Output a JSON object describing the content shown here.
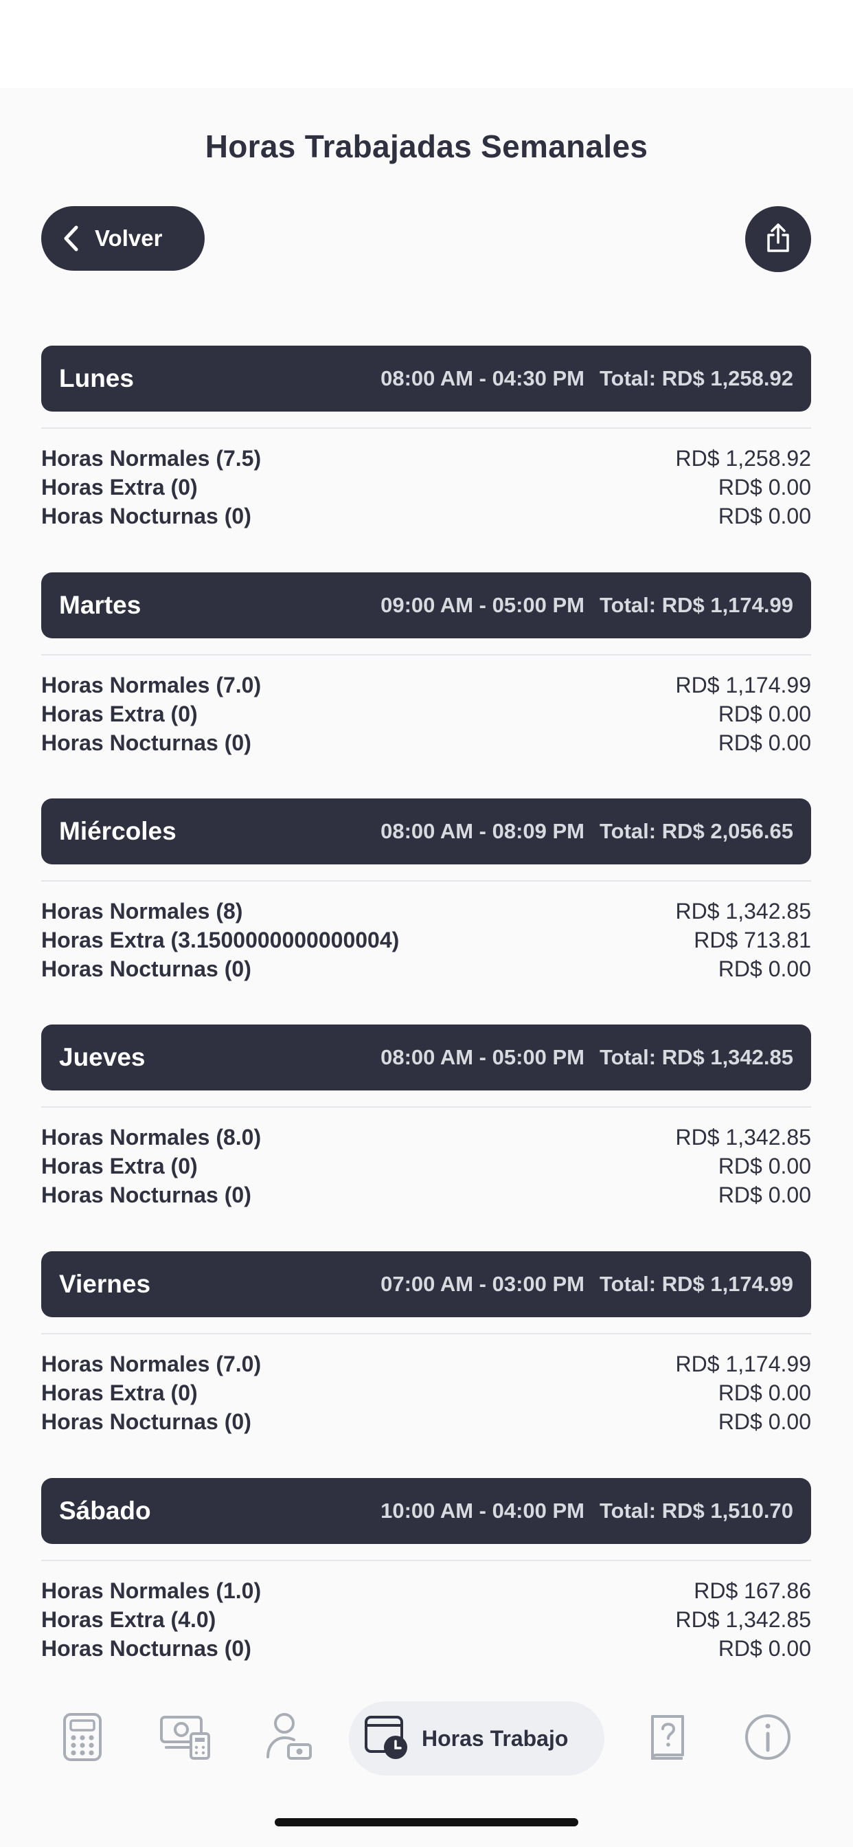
{
  "header": {
    "title": "Horas Trabajadas Semanales",
    "back_label": "Volver"
  },
  "days": [
    {
      "name": "Lunes",
      "hours": "08:00 AM - 04:30 PM",
      "total": "Total: RD$ 1,258.92",
      "lines": [
        {
          "label": "Horas Normales (7.5)",
          "amount": "RD$ 1,258.92"
        },
        {
          "label": "Horas Extra (0)",
          "amount": "RD$ 0.00"
        },
        {
          "label": "Horas Nocturnas (0)",
          "amount": "RD$ 0.00"
        }
      ]
    },
    {
      "name": "Martes",
      "hours": "09:00 AM - 05:00 PM",
      "total": "Total: RD$ 1,174.99",
      "lines": [
        {
          "label": "Horas Normales (7.0)",
          "amount": "RD$ 1,174.99"
        },
        {
          "label": "Horas Extra (0)",
          "amount": "RD$ 0.00"
        },
        {
          "label": "Horas Nocturnas (0)",
          "amount": "RD$ 0.00"
        }
      ]
    },
    {
      "name": "Miércoles",
      "hours": "08:00 AM - 08:09 PM",
      "total": "Total: RD$ 2,056.65",
      "lines": [
        {
          "label": "Horas Normales (8)",
          "amount": "RD$ 1,342.85"
        },
        {
          "label": "Horas Extra (3.1500000000000004)",
          "amount": "RD$ 713.81"
        },
        {
          "label": "Horas Nocturnas (0)",
          "amount": "RD$ 0.00"
        }
      ]
    },
    {
      "name": "Jueves",
      "hours": "08:00 AM - 05:00 PM",
      "total": "Total: RD$ 1,342.85",
      "lines": [
        {
          "label": "Horas Normales (8.0)",
          "amount": "RD$ 1,342.85"
        },
        {
          "label": "Horas Extra (0)",
          "amount": "RD$ 0.00"
        },
        {
          "label": "Horas Nocturnas (0)",
          "amount": "RD$ 0.00"
        }
      ]
    },
    {
      "name": "Viernes",
      "hours": "07:00 AM - 03:00 PM",
      "total": "Total: RD$ 1,174.99",
      "lines": [
        {
          "label": "Horas Normales (7.0)",
          "amount": "RD$ 1,174.99"
        },
        {
          "label": "Horas Extra (0)",
          "amount": "RD$ 0.00"
        },
        {
          "label": "Horas Nocturnas (0)",
          "amount": "RD$ 0.00"
        }
      ]
    },
    {
      "name": "Sábado",
      "hours": "10:00 AM - 04:00 PM",
      "total": "Total: RD$ 1,510.70",
      "lines": [
        {
          "label": "Horas Normales (1.0)",
          "amount": "RD$ 167.86"
        },
        {
          "label": "Horas Extra (4.0)",
          "amount": "RD$ 1,342.85"
        },
        {
          "label": "Horas Nocturnas (0)",
          "amount": "RD$ 0.00"
        }
      ]
    }
  ],
  "nav": {
    "items": [
      "calculator-icon",
      "money-icon",
      "user-pay-icon",
      "calendar-clock-icon",
      "help-book-icon",
      "info-icon"
    ],
    "active_label": "Horas Trabajo"
  },
  "colors": {
    "dark": "#2f3140",
    "background": "#fafafa",
    "nav_inactive": "#a9adb6"
  }
}
